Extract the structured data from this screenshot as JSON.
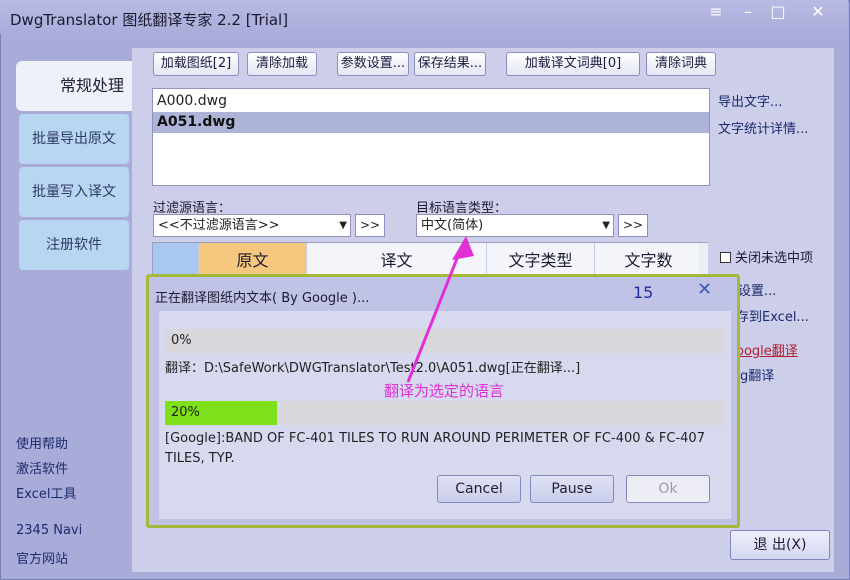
{
  "window": {
    "title": "DwgTranslator 图纸翻译专家 2.2 [Trial]"
  },
  "sidebar": {
    "tabs": [
      {
        "label": "常规处理"
      },
      {
        "label": "批量导出原文"
      },
      {
        "label": "批量写入译文"
      },
      {
        "label": "注册软件"
      }
    ],
    "links": [
      {
        "label": "使用帮助"
      },
      {
        "label": "激活软件"
      },
      {
        "label": "Excel工具"
      },
      {
        "label": "2345 Navi"
      },
      {
        "label": "官方网站"
      }
    ]
  },
  "toolbar": {
    "load_drawing": "加载图纸[2]",
    "clear_load": "清除加载",
    "params": "参数设置...",
    "save_results": "保存结果...",
    "load_dict": "加载译文词典[0]",
    "clear_dict": "清除词典"
  },
  "files": [
    "A000.dwg",
    "A051.dwg"
  ],
  "right_links": {
    "export_text": "导出文字...",
    "text_stats": "文字统计详情...",
    "close_unselected": "关闭未选中项",
    "settings_partial": "设置...",
    "save_excel_partial": "存到Excel...",
    "google_translate_partial": "oogle翻译",
    "bing_translate_partial": "g翻译"
  },
  "filter": {
    "source_label": "过滤源语言：",
    "source_value": "<<不过滤源语言>>",
    "target_label": "目标语言类型：",
    "target_value": "中文(简体)",
    "more": ">>"
  },
  "grid": {
    "columns": [
      "原文",
      "译文",
      "文字类型",
      "文字数"
    ]
  },
  "dialog": {
    "title": "正在翻译图纸内文本( By Google )...",
    "count": "15",
    "progress1_text": "0%",
    "progress1_value": 0,
    "file_line": "翻译：D:\\SafeWork\\DWGTranslator\\Test2.0\\A051.dwg[正在翻译...]",
    "progress2_text": "20%",
    "progress2_value": 0.2,
    "current_text_line1": "[Google]:BAND OF FC-401 TILES TO RUN AROUND PERIMETER OF FC-400 & FC-407",
    "current_text_line2": "TILES, TYP.",
    "cancel": "Cancel",
    "pause": "Pause",
    "ok": "Ok"
  },
  "annotation": "翻译为选定的语言",
  "exit_label": "退 出(X)",
  "colors": {
    "accent": "#a9acd8",
    "progress_fill": "#7ee01a",
    "annotation": "#e12fd5",
    "dialog_border": "#a4b83c"
  }
}
